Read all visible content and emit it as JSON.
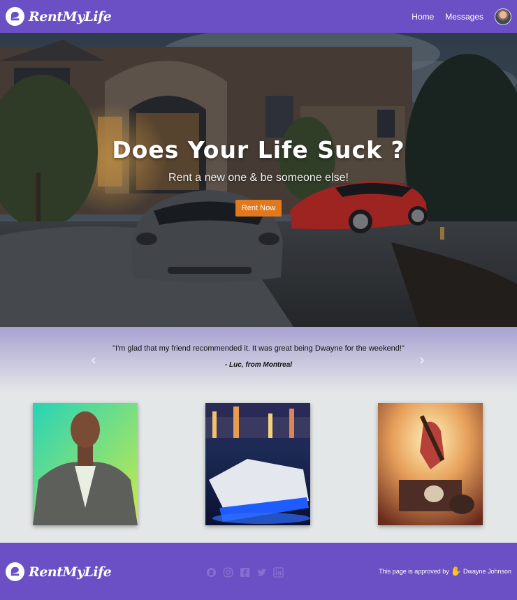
{
  "brand": {
    "name": "RentMyLife"
  },
  "nav": {
    "home": "Home",
    "messages": "Messages"
  },
  "hero": {
    "title": "Does Your Life Suck ?",
    "subtitle": "Rent a new one & be someone else!",
    "cta": "Rent Now"
  },
  "testimonial": {
    "quote": "\"I'm glad that my friend recommended it. It was great being Dwayne for the weekend!\"",
    "author": "- Luc, from Montreal"
  },
  "cards": [
    {
      "subject": "man-in-suit-portrait"
    },
    {
      "subject": "yacht-at-night"
    },
    {
      "subject": "guitarist-jumping-on-stage"
    }
  ],
  "footer": {
    "approved_prefix": "This page is approved by",
    "approved_name": "Dwayne Johnson",
    "social_icons": [
      "github-icon",
      "instagram-icon",
      "facebook-icon",
      "twitter-icon",
      "linkedin-icon"
    ]
  },
  "colors": {
    "brand_purple": "#6b4fc4",
    "cta_orange": "#e2781e"
  }
}
